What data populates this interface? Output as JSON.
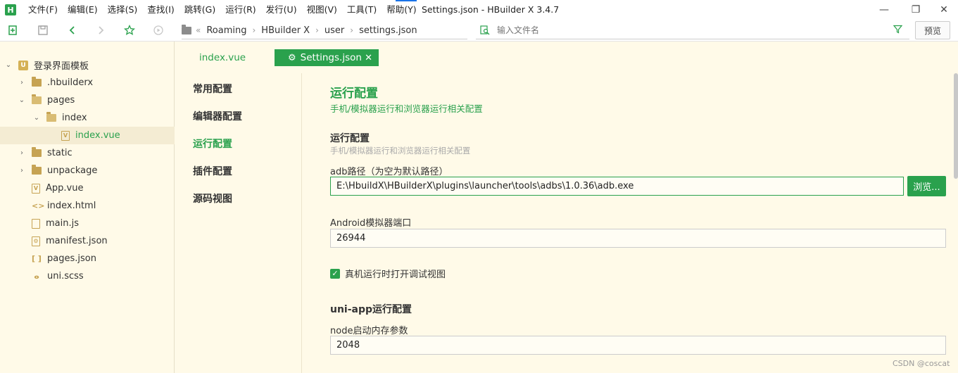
{
  "app": {
    "logo": "H",
    "window_title": "Settings.json - HBuilder X 3.4.7"
  },
  "menu": [
    "文件(F)",
    "编辑(E)",
    "选择(S)",
    "查找(I)",
    "跳转(G)",
    "运行(R)",
    "发行(U)",
    "视图(V)",
    "工具(T)",
    "帮助(Y)"
  ],
  "window_controls": {
    "minimize": "—",
    "maximize": "❐",
    "close": "✕"
  },
  "toolbar": {
    "icons": [
      "new-file-icon",
      "save-icon",
      "back-icon",
      "forward-icon",
      "star-icon",
      "run-icon"
    ],
    "breadcrumb": [
      "Roaming",
      "HBuilder X",
      "user",
      "settings.json"
    ],
    "breadcrumb_overflow": "«",
    "search_placeholder": "输入文件名",
    "preview_label": "预览"
  },
  "sidebar": {
    "items": [
      {
        "label": "登录界面模板",
        "type": "project",
        "expanded": true
      },
      {
        "label": ".hbuilderx",
        "type": "folder",
        "expanded": false
      },
      {
        "label": "pages",
        "type": "folder",
        "expanded": true
      },
      {
        "label": "index",
        "type": "folder",
        "expanded": true
      },
      {
        "label": "index.vue",
        "type": "vue",
        "selected": true
      },
      {
        "label": "static",
        "type": "folder",
        "expanded": false
      },
      {
        "label": "unpackage",
        "type": "folder",
        "expanded": false
      },
      {
        "label": "App.vue",
        "type": "vue"
      },
      {
        "label": "index.html",
        "type": "html"
      },
      {
        "label": "main.js",
        "type": "js"
      },
      {
        "label": "manifest.json",
        "type": "manifest"
      },
      {
        "label": "pages.json",
        "type": "json"
      },
      {
        "label": "uni.scss",
        "type": "scss"
      }
    ]
  },
  "tabs": [
    {
      "label": "index.vue",
      "active": false
    },
    {
      "label": "Settings.json",
      "active": true
    }
  ],
  "settings_nav": [
    {
      "label": "常用配置",
      "active": false
    },
    {
      "label": "编辑器配置",
      "active": false
    },
    {
      "label": "运行配置",
      "active": true
    },
    {
      "label": "插件配置",
      "active": false
    },
    {
      "label": "源码视图",
      "active": false
    }
  ],
  "content": {
    "title": "运行配置",
    "subtitle": "手机/模拟器运行和浏览器运行相关配置",
    "section1": {
      "title": "运行配置",
      "subtitle": "手机/模拟器运行和浏览器运行相关配置",
      "adb_label": "adb路径（为空为默认路径）",
      "adb_value": "E:\\HbuildX\\HBuilderX\\plugins\\launcher\\tools\\adbs\\1.0.36\\adb.exe",
      "browse_label": "浏览...",
      "android_port_label": "Android模拟器端口",
      "android_port_value": "26944",
      "debug_view_label": "真机运行时打开调试视图",
      "debug_view_checked": true
    },
    "section2": {
      "title": "uni-app运行配置",
      "node_mem_label": "node启动内存参数",
      "node_mem_value": "2048"
    }
  },
  "watermark": "CSDN @coscat",
  "colors": {
    "accent": "#2aa14d",
    "background": "#fffae8",
    "folder": "#c6a353"
  }
}
